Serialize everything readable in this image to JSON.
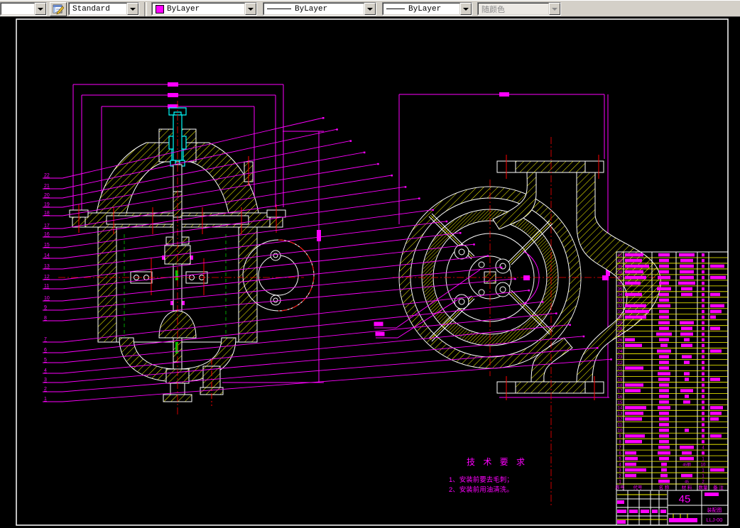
{
  "toolbar": {
    "style_combo": {
      "label": "Standard"
    },
    "color_combo": {
      "label": "ByLayer",
      "swatch": "#FF00FF"
    },
    "linetype_combo": {
      "label": "ByLayer"
    },
    "lineweight_combo": {
      "label": "ByLayer"
    },
    "plot_style_combo": {
      "label": "随颜色",
      "disabled": true
    }
  },
  "colors": {
    "dimension": "#FF00FF",
    "hatch": "#FFFF00",
    "centerline": "#FF0000",
    "outline": "#FFFFFF",
    "auxiliary": "#00CC00",
    "detail_part": "#00FFFF"
  },
  "tech_requirements": {
    "title": "技 术 要 求",
    "items": [
      "1、安装前要去毛刺；",
      "2、安装前用油清洗。"
    ]
  },
  "balloons": {
    "left": [
      "22",
      "21",
      "20",
      "19",
      "18",
      "17",
      "16",
      "15",
      "14",
      "13",
      "12",
      "11",
      "10",
      "9",
      "8",
      "7",
      "6",
      "5",
      "4",
      "3",
      "2",
      "1"
    ]
  },
  "bom": {
    "headers": [
      "序号",
      "代号",
      "名 称",
      "材 料",
      "数量",
      "备 注"
    ],
    "rows": [
      {
        "no": "41",
        "code_w": 26,
        "name_w": 16,
        "mat_w": 22,
        "qty": "",
        "note_w": 0
      },
      {
        "no": "40",
        "code_w": 24,
        "name_w": 14,
        "mat_w": 18,
        "qty": "",
        "note_w": 0
      },
      {
        "no": "39",
        "code_w": 34,
        "name_w": 14,
        "mat_w": 20,
        "qty": "",
        "note_w": 20
      },
      {
        "no": "38",
        "code_w": 26,
        "name_w": 14,
        "mat_w": 20,
        "qty": "",
        "note_w": 0
      },
      {
        "no": "37",
        "code_w": 30,
        "name_w": 18,
        "mat_w": 20,
        "qty": "",
        "note_w": 22
      },
      {
        "no": "36",
        "code_w": 22,
        "name_w": 14,
        "mat_w": 24,
        "qty": "",
        "note_w": 0
      },
      {
        "no": "35",
        "code_w": 0,
        "name_w": 20,
        "mat_w": 16,
        "qty": "",
        "note_w": 0
      },
      {
        "no": "34",
        "code_w": 24,
        "name_w": 14,
        "mat_w": 16,
        "qty": "",
        "note_w": 14
      },
      {
        "no": "33",
        "code_w": 0,
        "name_w": 14,
        "mat_w": 0,
        "qty": "",
        "note_w": 0
      },
      {
        "no": "32",
        "code_w": 30,
        "name_w": 18,
        "mat_w": 0,
        "qty": "",
        "note_w": 20
      },
      {
        "no": "31",
        "code_w": 34,
        "name_w": 14,
        "mat_w": 0,
        "qty": "",
        "note_w": 16
      },
      {
        "no": "30",
        "code_w": 30,
        "name_w": 14,
        "mat_w": 0,
        "qty": "",
        "note_w": 8
      },
      {
        "no": "29",
        "code_w": 0,
        "name_w": 16,
        "mat_w": 20,
        "qty": "",
        "note_w": 0
      },
      {
        "no": "28",
        "code_w": 0,
        "name_w": 14,
        "mat_w": 16,
        "qty": "",
        "note_w": 14
      },
      {
        "no": "27",
        "code_w": 0,
        "name_w": 22,
        "mat_w": 18,
        "qty": "",
        "note_w": 0
      },
      {
        "no": "26",
        "code_w": 14,
        "name_w": 14,
        "mat_w": 8,
        "qty": "",
        "note_w": 0
      },
      {
        "no": "25",
        "code_w": 24,
        "name_w": 10,
        "mat_w": 16,
        "qty": "",
        "note_w": 0
      },
      {
        "no": "24",
        "code_w": 0,
        "name_w": 20,
        "mat_w": 0,
        "qty": "",
        "note_w": 16
      },
      {
        "no": "23",
        "code_w": 0,
        "name_w": 14,
        "mat_w": 14,
        "qty": "",
        "note_w": 0
      },
      {
        "no": "22",
        "code_w": 0,
        "name_w": 14,
        "mat_w": 8,
        "qty": "",
        "note_w": 0
      },
      {
        "no": "21",
        "code_w": 26,
        "name_w": 14,
        "mat_w": 0,
        "qty": "",
        "note_w": 0
      },
      {
        "no": "20",
        "code_w": 0,
        "name_w": 18,
        "mat_w": 8,
        "qty": "",
        "note_w": 0
      },
      {
        "no": "19",
        "code_w": 0,
        "name_w": 16,
        "mat_w": 6,
        "qty": "",
        "note_w": 14
      },
      {
        "no": "18",
        "code_w": 26,
        "name_w": 14,
        "mat_w": 0,
        "qty": "",
        "note_w": 0
      },
      {
        "no": "17",
        "code_w": 22,
        "name_w": 14,
        "mat_w": 18,
        "qty": "",
        "note_w": 0
      },
      {
        "no": "16",
        "code_w": 0,
        "name_w": 14,
        "mat_w": 6,
        "qty": "",
        "note_w": 0
      },
      {
        "no": "15",
        "code_w": 0,
        "name_w": 14,
        "mat_w": 10,
        "qty": "",
        "note_w": 0
      },
      {
        "no": "14",
        "code_w": 30,
        "name_w": 18,
        "mat_w": 0,
        "qty": "",
        "note_w": 18
      },
      {
        "no": "13",
        "code_w": 26,
        "name_w": 14,
        "mat_w": 0,
        "qty": "",
        "note_w": 16
      },
      {
        "no": "12",
        "code_w": 24,
        "name_w": 14,
        "mat_w": 0,
        "qty": "",
        "note_w": 12
      },
      {
        "no": "11",
        "code_w": 0,
        "name_w": 14,
        "mat_w": 0,
        "qty": "",
        "note_w": 0
      },
      {
        "no": "10",
        "code_w": 0,
        "name_w": 14,
        "mat_w": 6,
        "qty": "",
        "note_w": 0
      },
      {
        "no": "9",
        "code_w": 28,
        "name_w": 14,
        "mat_w": 0,
        "qty": "",
        "note_w": 16
      },
      {
        "no": "8",
        "code_w": 24,
        "name_w": 14,
        "mat_w": 0,
        "qty": "",
        "note_w": 0
      },
      {
        "no": "7",
        "code_w": 0,
        "name_w": 16,
        "mat_w": 20,
        "qty": "4",
        "note_w": 0
      },
      {
        "no": "6",
        "code_w": 16,
        "name_w": 18,
        "mat_w": 14,
        "qty": "",
        "note_w": 0
      },
      {
        "no": "5",
        "code_w": 18,
        "name_w": 14,
        "mat_w": 20,
        "qty": "1",
        "note_w": 0
      },
      {
        "no": "4",
        "code_w": 16,
        "name_w": 8,
        "mat": "45钢",
        "mat_w": 0,
        "qty": "10",
        "note_w": 0
      },
      {
        "no": "3",
        "code_w": 30,
        "name_w": 8,
        "mat_w": 0,
        "qty": "1",
        "note_w": 20
      },
      {
        "no": "2",
        "code_w": 16,
        "name_w": 10,
        "mat_w": 16,
        "qty": "1",
        "note_w": 0
      },
      {
        "no": "1",
        "code_w": 0,
        "name_w": 16,
        "mat": "45",
        "mat_w": 0,
        "qty": "2",
        "note_w": 0
      }
    ]
  },
  "title_block": {
    "material": "45",
    "doc_type": "装配图",
    "drawing_no": "LLJ-00"
  }
}
